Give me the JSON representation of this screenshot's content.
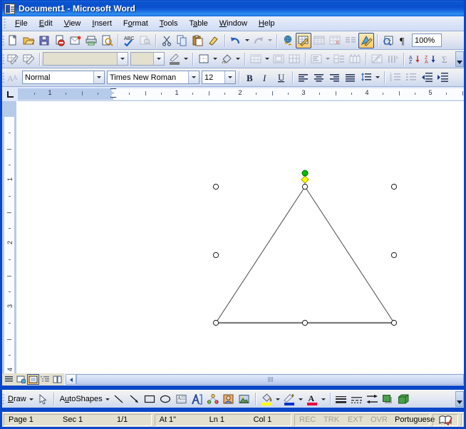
{
  "window": {
    "title": "Document1 - Microsoft Word",
    "icon": "word-document-icon"
  },
  "menubar": {
    "items": [
      {
        "label": "File",
        "accel": "F"
      },
      {
        "label": "Edit",
        "accel": "E"
      },
      {
        "label": "View",
        "accel": "V"
      },
      {
        "label": "Insert",
        "accel": "I"
      },
      {
        "label": "Format",
        "accel": "o"
      },
      {
        "label": "Tools",
        "accel": "T"
      },
      {
        "label": "Table",
        "accel": "a"
      },
      {
        "label": "Window",
        "accel": "W"
      },
      {
        "label": "Help",
        "accel": "H"
      }
    ]
  },
  "standard_toolbar": {
    "buttons": [
      {
        "name": "new-blank-document",
        "title": "New Blank Document"
      },
      {
        "name": "open",
        "title": "Open"
      },
      {
        "name": "save",
        "title": "Save"
      },
      {
        "name": "permission",
        "title": "Permission"
      },
      {
        "name": "email",
        "title": "E-mail"
      },
      {
        "name": "print",
        "title": "Print"
      },
      {
        "name": "print-preview",
        "title": "Print Preview"
      },
      {
        "name": "spelling-and-grammar",
        "title": "Spelling and Grammar"
      },
      {
        "name": "research",
        "title": "Research"
      },
      {
        "name": "cut",
        "title": "Cut"
      },
      {
        "name": "copy",
        "title": "Copy"
      },
      {
        "name": "paste",
        "title": "Paste"
      },
      {
        "name": "format-painter",
        "title": "Format Painter"
      },
      {
        "name": "undo",
        "title": "Undo"
      },
      {
        "name": "redo",
        "title": "Redo"
      },
      {
        "name": "insert-hyperlink",
        "title": "Insert Hyperlink"
      },
      {
        "name": "tables-and-borders",
        "title": "Tables and Borders"
      },
      {
        "name": "insert-table",
        "title": "Insert Table"
      },
      {
        "name": "insert-excel-spreadsheet",
        "title": "Insert Microsoft Excel Worksheet"
      },
      {
        "name": "columns",
        "title": "Columns"
      },
      {
        "name": "drawing",
        "title": "Drawing"
      },
      {
        "name": "document-map",
        "title": "Document Map"
      },
      {
        "name": "show-hide-formatting",
        "title": "Show/Hide"
      }
    ],
    "zoom_value": "100%"
  },
  "tables_toolbar": {
    "line_style_value": "",
    "line_weight_value": "",
    "buttons": [
      {
        "name": "draw-table"
      },
      {
        "name": "eraser"
      },
      {
        "name": "border-color"
      },
      {
        "name": "outside-border"
      },
      {
        "name": "shading-color"
      },
      {
        "name": "insert-table-dropdown"
      },
      {
        "name": "merge-cells"
      },
      {
        "name": "split-cells"
      },
      {
        "name": "align-top-left"
      },
      {
        "name": "distribute-rows-evenly"
      },
      {
        "name": "distribute-columns-evenly"
      },
      {
        "name": "table-autoformat"
      },
      {
        "name": "change-text-direction"
      },
      {
        "name": "sort-ascending"
      },
      {
        "name": "sort-descending"
      },
      {
        "name": "autosum"
      }
    ]
  },
  "formatting_toolbar": {
    "style_value": "Normal",
    "font_value": "Times New Roman",
    "size_value": "12",
    "buttons": [
      {
        "name": "bold",
        "glyph": "B"
      },
      {
        "name": "italic",
        "glyph": "I"
      },
      {
        "name": "underline",
        "glyph": "U"
      },
      {
        "name": "align-left"
      },
      {
        "name": "align-center"
      },
      {
        "name": "align-right"
      },
      {
        "name": "justify"
      },
      {
        "name": "line-spacing"
      },
      {
        "name": "numbering"
      },
      {
        "name": "bullets"
      },
      {
        "name": "decrease-indent"
      },
      {
        "name": "increase-indent"
      }
    ]
  },
  "ruler": {
    "tab_stop_type": "left-tab",
    "horizontal_labels": [
      "1",
      "1",
      "2",
      "3",
      "4",
      "5"
    ],
    "vertical_labels": [
      "1",
      "2",
      "3"
    ],
    "unit": "inch"
  },
  "document": {
    "shape": {
      "name": "isosceles-triangle",
      "selected": true,
      "handles": 8,
      "rotation_handle_color": "#00c000",
      "adjustment_handle_color": "#ffff00",
      "line_color": "#595959"
    }
  },
  "view_buttons": [
    {
      "name": "normal-view",
      "active": false
    },
    {
      "name": "web-layout-view",
      "active": false
    },
    {
      "name": "print-layout-view",
      "active": true
    },
    {
      "name": "outline-view",
      "active": false
    },
    {
      "name": "reading-layout-view",
      "active": false
    }
  ],
  "drawing_toolbar": {
    "draw_label": "Draw",
    "draw_accel": "D",
    "autoshapes_label": "AutoShapes",
    "autoshapes_accel": "u",
    "buttons": [
      {
        "name": "select-objects"
      },
      {
        "name": "line"
      },
      {
        "name": "arrow"
      },
      {
        "name": "rectangle"
      },
      {
        "name": "oval"
      },
      {
        "name": "text-box"
      },
      {
        "name": "insert-wordart"
      },
      {
        "name": "insert-diagram"
      },
      {
        "name": "insert-clip-art"
      },
      {
        "name": "insert-picture"
      },
      {
        "name": "fill-color",
        "color": "#ffff00"
      },
      {
        "name": "line-color",
        "color": "#0033cc"
      },
      {
        "name": "font-color",
        "color": "#e8003c"
      },
      {
        "name": "line-style"
      },
      {
        "name": "dash-style"
      },
      {
        "name": "arrow-style"
      },
      {
        "name": "shadow-style"
      },
      {
        "name": "3-d-style"
      }
    ]
  },
  "statusbar": {
    "page": "Page 1",
    "section": "Sec 1",
    "pages": "1/1",
    "at": "At 1\"",
    "line": "Ln 1",
    "column": "Col 1",
    "rec": "REC",
    "trk": "TRK",
    "ext": "EXT",
    "ovr": "OVR",
    "language": "Portuguese",
    "spelling_icon": "spelling-status-icon"
  }
}
